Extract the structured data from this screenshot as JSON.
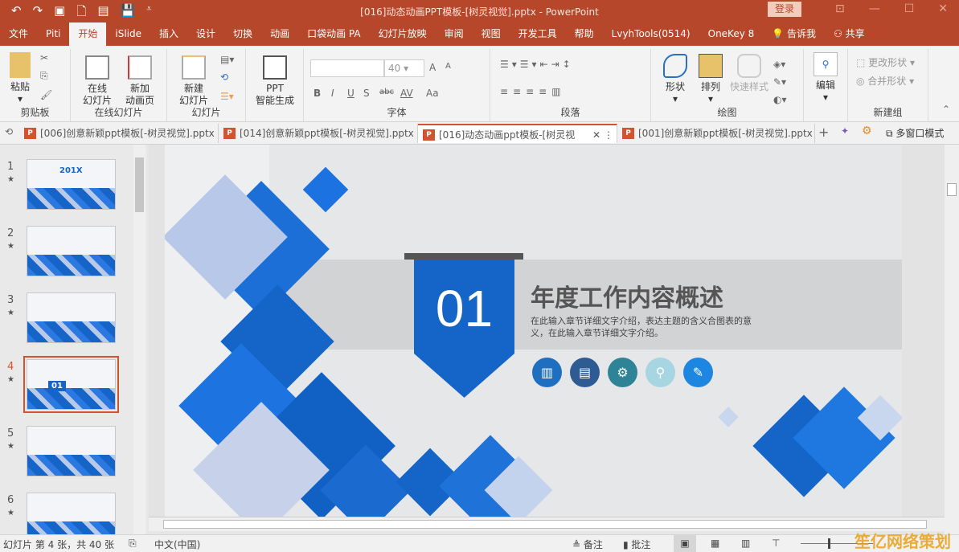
{
  "window": {
    "title": "[016]动态动画PPT模板-[树灵视觉].pptx  -  PowerPoint",
    "login": "登录"
  },
  "ribbon_tabs": [
    "文件",
    "Piti",
    "开始",
    "iSlide",
    "插入",
    "设计",
    "切换",
    "动画",
    "口袋动画 PA",
    "幻灯片放映",
    "审阅",
    "视图",
    "开发工具",
    "帮助",
    "LvyhTools(0514)",
    "OneKey 8",
    "告诉我",
    "共享"
  ],
  "ribbon": {
    "clipboard": {
      "paste": "粘贴",
      "label": "剪贴板"
    },
    "online": {
      "online_slide": "在线\n幻灯片",
      "add_anim": "新加\n动画页",
      "label": "在线幻灯片"
    },
    "slides": {
      "new_slide": "新建\n幻灯片",
      "label": "幻灯片"
    },
    "ppt": {
      "gen": "PPT\n智能生成"
    },
    "font": {
      "size": "40",
      "bold": "B",
      "italic": "I",
      "underline": "U",
      "shadow": "S",
      "strike": "abc",
      "spacing": "AV",
      "case": "Aa",
      "grow": "A",
      "label": "字体"
    },
    "paragraph": {
      "label": "段落"
    },
    "drawing": {
      "shape": "形状",
      "arrange": "排列",
      "quick": "快速样式",
      "label": "绘图"
    },
    "edit": {
      "label": "编辑"
    },
    "newgroup": {
      "change_shape": "更改形状",
      "merge_shape": "合并形状",
      "label": "新建组"
    }
  },
  "doc_tabs": [
    {
      "label": "[006]创意新颖ppt模板[-树灵视觉].pptx"
    },
    {
      "label": "[014]创意新颖ppt模板[-树灵视觉].pptx"
    },
    {
      "label": "[016]动态动画ppt模板-[树灵视"
    },
    {
      "label": "[001]创意新颖ppt模板[-树灵视觉].pptx"
    }
  ],
  "multiwindow": "多窗口模式",
  "thumbnails": [
    {
      "num": "1",
      "text": "201X"
    },
    {
      "num": "2"
    },
    {
      "num": "3"
    },
    {
      "num": "4",
      "text": "01"
    },
    {
      "num": "5"
    },
    {
      "num": "6"
    }
  ],
  "slide": {
    "number": "01",
    "title": "年度工作内容概述",
    "body": "在此输入章节详细文字介绍，表达主题的含义合图表的意义，在此输入章节详细文字介绍。",
    "icon_colors": [
      "#1f6fc1",
      "#2f5b93",
      "#2e8496",
      "#a8d5e2",
      "#1c86e0"
    ]
  },
  "status": {
    "slide_info": "幻灯片 第 4 张，共 40 张",
    "language": "中文(中国)",
    "notes": "备注",
    "comments": "批注"
  },
  "watermark": "笙亿网络策划",
  "colors": {
    "accent": "#b7472a",
    "blue": "#1565c9"
  }
}
